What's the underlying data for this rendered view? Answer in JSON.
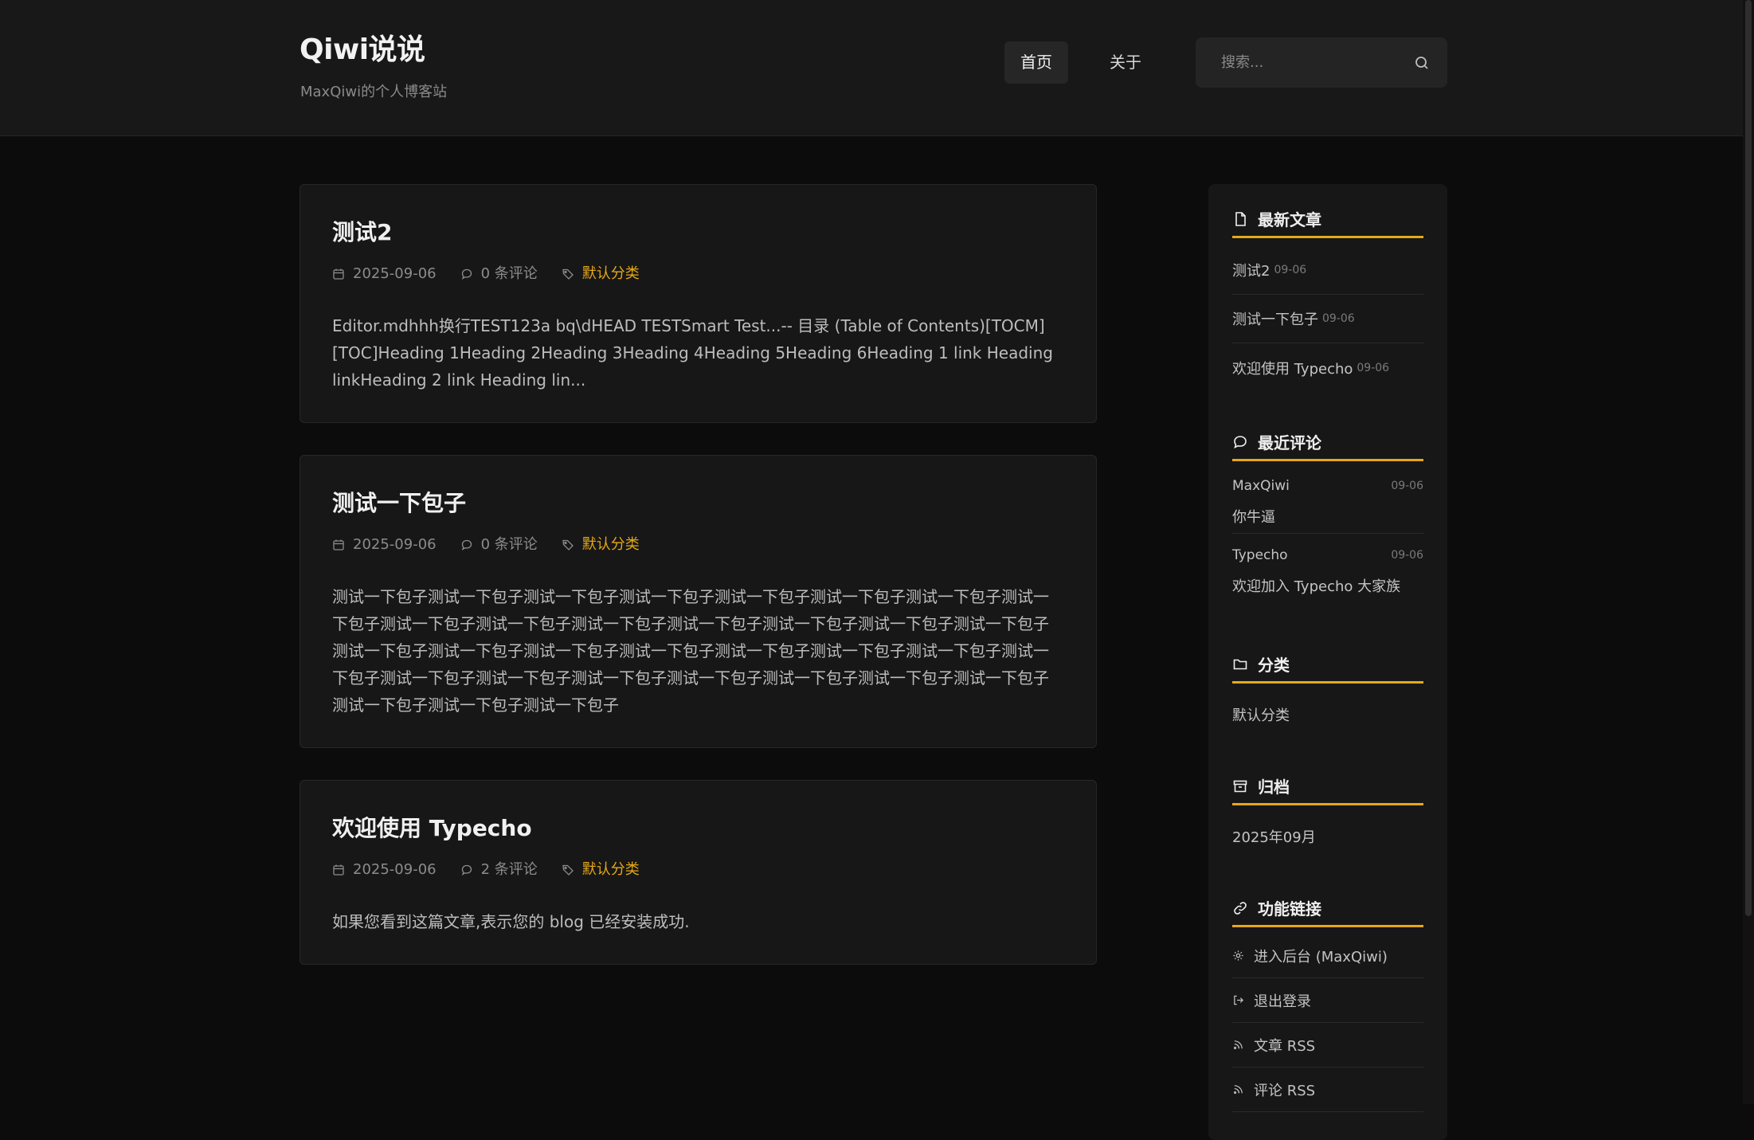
{
  "site": {
    "title": "Qiwi说说",
    "description": "MaxQiwi的个人博客站"
  },
  "nav": {
    "items": [
      {
        "label": "首页"
      },
      {
        "label": "关于"
      }
    ]
  },
  "search": {
    "placeholder": "搜索..."
  },
  "posts": [
    {
      "title": "测试2",
      "date": "2025-09-06",
      "comments": "0 条评论",
      "category": "默认分类",
      "excerpt": "Editor.mdhhh换行TEST123a bq\\dHEAD TESTSmart Test...-- 目录 (Table of Contents)[TOCM][TOC]Heading 1Heading 2Heading 3Heading 4Heading 5Heading 6Heading 1 link Heading linkHeading 2 link Heading lin..."
    },
    {
      "title": "测试一下包子",
      "date": "2025-09-06",
      "comments": "0 条评论",
      "category": "默认分类",
      "excerpt": "测试一下包子测试一下包子测试一下包子测试一下包子测试一下包子测试一下包子测试一下包子测试一下包子测试一下包子测试一下包子测试一下包子测试一下包子测试一下包子测试一下包子测试一下包子测试一下包子测试一下包子测试一下包子测试一下包子测试一下包子测试一下包子测试一下包子测试一下包子测试一下包子测试一下包子测试一下包子测试一下包子测试一下包子测试一下包子测试一下包子测试一下包子测试一下包子测试一下包子"
    },
    {
      "title": "欢迎使用 Typecho",
      "date": "2025-09-06",
      "comments": "2 条评论",
      "category": "默认分类",
      "excerpt": "如果您看到这篇文章,表示您的 blog 已经安装成功."
    }
  ],
  "sidebar": {
    "recent_posts": {
      "title": "最新文章",
      "items": [
        {
          "label": "测试2",
          "date": "09-06"
        },
        {
          "label": "测试一下包子",
          "date": "09-06"
        },
        {
          "label": "欢迎使用 Typecho",
          "date": "09-06"
        }
      ]
    },
    "recent_comments": {
      "title": "最近评论",
      "items": [
        {
          "author": "MaxQiwi",
          "date": "09-06",
          "text": "你牛逼"
        },
        {
          "author": "Typecho",
          "date": "09-06",
          "text": "欢迎加入 Typecho 大家族"
        }
      ]
    },
    "categories": {
      "title": "分类",
      "items": [
        {
          "label": "默认分类"
        }
      ]
    },
    "archive": {
      "title": "归档",
      "items": [
        {
          "label": "2025年09月"
        }
      ]
    },
    "functions": {
      "title": "功能链接",
      "items": [
        {
          "label": "进入后台 (MaxQiwi)",
          "icon": "gear-icon"
        },
        {
          "label": "退出登录",
          "icon": "logout-icon"
        },
        {
          "label": "文章 RSS",
          "icon": "rss-icon"
        },
        {
          "label": "评论 RSS",
          "icon": "rss-icon"
        }
      ]
    }
  },
  "colors": {
    "accent": "#e6a817",
    "background": "#0c0c0c",
    "card": "#171717",
    "header": "#181818"
  }
}
